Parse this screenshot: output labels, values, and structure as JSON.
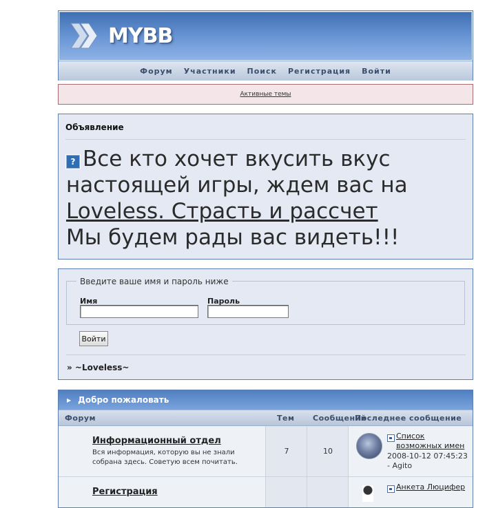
{
  "logo": {
    "text": "MYBB"
  },
  "nav": {
    "items": [
      "Форум",
      "Участники",
      "Поиск",
      "Регистрация",
      "Войти"
    ]
  },
  "active_topics": {
    "label": "Активные темы"
  },
  "announcement": {
    "title": "Объявление",
    "line_prefix": "Все кто хочет вкусить вкус настоящей игры, ждем вас на",
    "link_text": "Loveless. Страсть и рассчет",
    "line_suffix": "Мы будем рады вас видеть!!!"
  },
  "login": {
    "legend": "Введите ваше имя и пароль ниже",
    "name_label": "Имя",
    "name_value": "",
    "password_label": "Пароль",
    "password_value": "",
    "submit_label": "Войти",
    "forum_name": "» ~Loveless~"
  },
  "forum_table": {
    "category": "Добро пожаловать",
    "columns": {
      "forum": "Форум",
      "topics": "Тем",
      "posts": "Сообщений",
      "last_post": "Последнее сообщение"
    },
    "rows": [
      {
        "title": "Информационный отдел",
        "description": "Вся информация, которую вы не знали собрана здесь. Советую всем почитать.",
        "topics": "7",
        "posts": "10",
        "last_post_title": "Список возможных имен",
        "last_post_date": "2008-10-12 07:45:23",
        "last_post_author": "Agito"
      },
      {
        "title": "Регистрация",
        "description": "",
        "topics": "",
        "posts": "",
        "last_post_title": "Анкета Люцифер",
        "last_post_date": "",
        "last_post_author": ""
      }
    ]
  },
  "colors": {
    "header_blue": "#4f7fc2",
    "panel_bg": "#e4e9f3",
    "active_bar_bg": "#f3e5e8",
    "border_blue": "#5c7fb0"
  },
  "icons": {
    "logo": "mybb-chevron-logo",
    "announcement": "question-icon",
    "category": "arrow-right-icon",
    "last_post": "last-post-icon"
  }
}
